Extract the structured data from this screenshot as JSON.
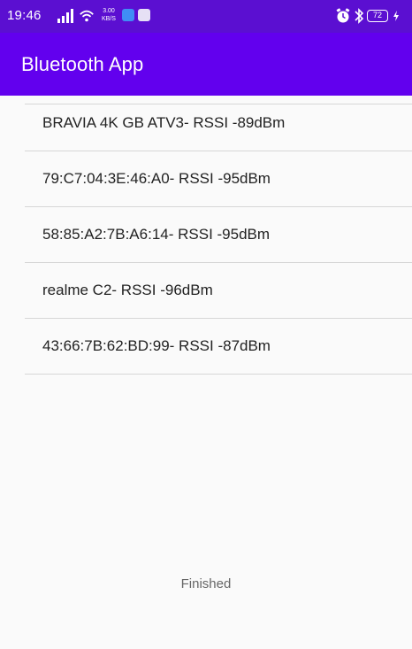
{
  "status_bar": {
    "time": "19:46",
    "speed_value": "3.00",
    "speed_unit": "KB/S",
    "battery_level": "72",
    "icons": [
      "signal-icon",
      "wifi-icon",
      "alarm-icon",
      "bluetooth-icon",
      "battery-icon",
      "charging-icon"
    ]
  },
  "toolbar": {
    "title": "Bluetooth App"
  },
  "devices": [
    {
      "label": "BRAVIA 4K GB ATV3- RSSI -89dBm"
    },
    {
      "label": "79:C7:04:3E:46:A0- RSSI -95dBm"
    },
    {
      "label": "58:85:A2:7B:A6:14- RSSI -95dBm"
    },
    {
      "label": "realme C2- RSSI -96dBm"
    },
    {
      "label": "43:66:7B:62:BD:99- RSSI -87dBm"
    }
  ],
  "scan": {
    "status": "Finished"
  },
  "colors": {
    "primary": "#6200ee",
    "status_bar": "#5b0fd1",
    "divider": "#d6d6d6",
    "text": "#222222",
    "muted_text": "#666666"
  }
}
